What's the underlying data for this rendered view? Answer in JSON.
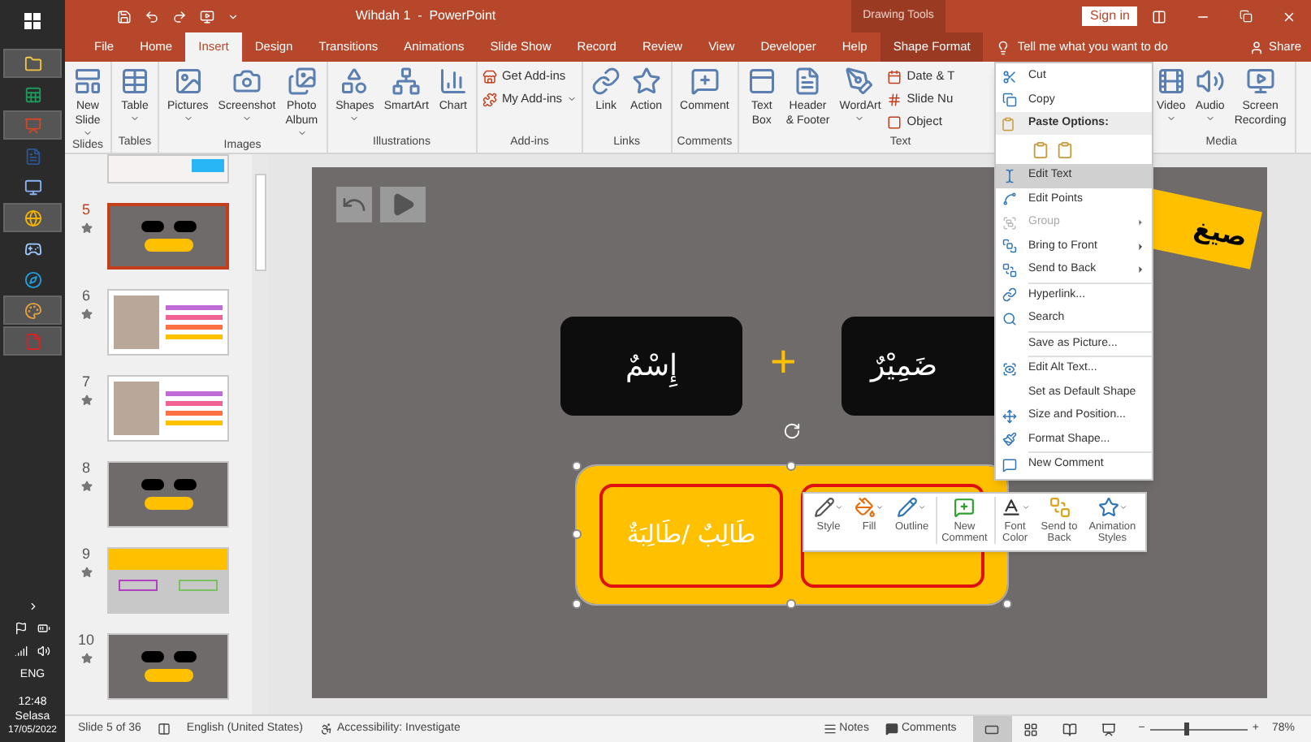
{
  "taskbar": {
    "apps": [
      {
        "running": true
      },
      {
        "running": false
      },
      {
        "running": true
      },
      {
        "running": false
      },
      {
        "running": false
      },
      {
        "running": true
      },
      {
        "running": false
      },
      {
        "running": false
      },
      {
        "running": true
      },
      {
        "running": true
      }
    ],
    "language": "ENG",
    "time": "12:48",
    "day": "Selasa",
    "date": "17/05/2022"
  },
  "title_bar": {
    "title": "Wihdah 1  -  PowerPoint",
    "context_label": "Drawing Tools",
    "sign_in": "Sign in"
  },
  "tabs": [
    {
      "label": "File",
      "selected": false,
      "kind": "normal"
    },
    {
      "label": "Home",
      "selected": false,
      "kind": "normal"
    },
    {
      "label": "Insert",
      "selected": true,
      "kind": "normal"
    },
    {
      "label": "Design",
      "selected": false,
      "kind": "normal"
    },
    {
      "label": "Transitions",
      "selected": false,
      "kind": "normal"
    },
    {
      "label": "Animations",
      "selected": false,
      "kind": "normal"
    },
    {
      "label": "Slide Show",
      "selected": false,
      "kind": "normal"
    },
    {
      "label": "Record",
      "selected": false,
      "kind": "normal"
    },
    {
      "label": "Review",
      "selected": false,
      "kind": "normal"
    },
    {
      "label": "View",
      "selected": false,
      "kind": "normal"
    },
    {
      "label": "Developer",
      "selected": false,
      "kind": "normal"
    },
    {
      "label": "Help",
      "selected": false,
      "kind": "normal"
    },
    {
      "label": "Shape Format",
      "selected": false,
      "kind": "contextual"
    }
  ],
  "tell_me": "Tell me what you want to do",
  "share": "Share",
  "ribbon": [
    {
      "label": "Slides",
      "buttons": [
        {
          "label": "New\nSlide",
          "kind": "large",
          "dropdown": true
        }
      ]
    },
    {
      "label": "Tables",
      "buttons": [
        {
          "label": "Table",
          "kind": "large",
          "dropdown": true
        }
      ]
    },
    {
      "label": "Images",
      "buttons": [
        {
          "label": "Pictures",
          "kind": "large",
          "dropdown": true
        },
        {
          "label": "Screenshot",
          "kind": "large",
          "dropdown": true
        },
        {
          "label": "Photo\nAlbum",
          "kind": "large",
          "dropdown": true
        }
      ]
    },
    {
      "label": "Illustrations",
      "buttons": [
        {
          "label": "Shapes",
          "kind": "large",
          "dropdown": true
        },
        {
          "label": "SmartArt",
          "kind": "large",
          "dropdown": false
        },
        {
          "label": "Chart",
          "kind": "large",
          "dropdown": false
        }
      ]
    },
    {
      "label": "Add-ins",
      "buttons": [
        {
          "label": "Get Add-ins",
          "kind": "small",
          "dropdown": false
        },
        {
          "label": "My Add-ins",
          "kind": "small",
          "dropdown": true
        }
      ]
    },
    {
      "label": "Links",
      "buttons": [
        {
          "label": "Link",
          "kind": "large",
          "dropdown": false
        },
        {
          "label": "Action",
          "kind": "large",
          "dropdown": false
        }
      ]
    },
    {
      "label": "Comments",
      "buttons": [
        {
          "label": "Comment",
          "kind": "large",
          "dropdown": false
        }
      ]
    },
    {
      "label": "Text",
      "buttons": [
        {
          "label": "Text\nBox",
          "kind": "large",
          "dropdown": false
        },
        {
          "label": "Header\n& Footer",
          "kind": "large",
          "dropdown": false
        },
        {
          "label": "WordArt",
          "kind": "large",
          "dropdown": true
        },
        {
          "label": "Date & T",
          "kind": "small",
          "dropdown": false
        },
        {
          "label": "Slide Nu",
          "kind": "small",
          "dropdown": false
        },
        {
          "label": "Object",
          "kind": "small",
          "dropdown": false
        }
      ]
    },
    {
      "label": "Media",
      "buttons": [
        {
          "label": "Video",
          "kind": "large",
          "dropdown": true
        },
        {
          "label": "Audio",
          "kind": "large",
          "dropdown": true
        },
        {
          "label": "Screen\nRecording",
          "kind": "large",
          "dropdown": false
        }
      ]
    }
  ],
  "thumbnails": [
    {
      "kind": "light",
      "selected": false
    },
    {
      "number": "5",
      "kind": "dark",
      "selected": true
    },
    {
      "number": "6",
      "kind": "photo",
      "selected": false
    },
    {
      "number": "7",
      "kind": "photo",
      "selected": false
    },
    {
      "number": "8",
      "kind": "dark",
      "selected": false
    },
    {
      "number": "9",
      "kind": "banner",
      "selected": false
    },
    {
      "number": "10",
      "kind": "dark",
      "selected": false
    }
  ],
  "slide": {
    "tag": "صيغ",
    "boxes": [
      {
        "text": "ضَمِيْرٌ"
      },
      {
        "text": "إِسْمٌ"
      }
    ],
    "plus": "+",
    "group": {
      "cell_text": "طَالِبٌ /طَالِبَةٌ",
      "selected": true
    }
  },
  "context_menu": [
    {
      "kind": "item",
      "label": "Cut",
      "selected": false,
      "disabled": false,
      "submenu": false
    },
    {
      "kind": "item",
      "label": "Copy",
      "selected": false,
      "disabled": false,
      "submenu": false
    },
    {
      "kind": "header",
      "label": "Paste Options:"
    },
    {
      "kind": "paste"
    },
    {
      "kind": "item",
      "label": "Edit Text",
      "selected": true,
      "disabled": false,
      "submenu": false
    },
    {
      "kind": "item",
      "label": "Edit Points",
      "selected": false,
      "disabled": false,
      "submenu": false
    },
    {
      "kind": "item",
      "label": "Group",
      "selected": false,
      "disabled": true,
      "submenu": true
    },
    {
      "kind": "item",
      "label": "Bring to Front",
      "selected": false,
      "disabled": false,
      "submenu": true
    },
    {
      "kind": "item",
      "label": "Send to Back",
      "selected": false,
      "disabled": false,
      "submenu": true
    },
    {
      "kind": "separator"
    },
    {
      "kind": "item",
      "label": "Hyperlink...",
      "selected": false,
      "disabled": false,
      "submenu": false
    },
    {
      "kind": "item",
      "label": "Search",
      "selected": false,
      "disabled": false,
      "submenu": false
    },
    {
      "kind": "separator"
    },
    {
      "kind": "item",
      "label": "Save as Picture...",
      "selected": false,
      "disabled": false,
      "submenu": false
    },
    {
      "kind": "separator"
    },
    {
      "kind": "item",
      "label": "Edit Alt Text...",
      "selected": false,
      "disabled": false,
      "submenu": false
    },
    {
      "kind": "item",
      "label": "Set as Default Shape",
      "selected": false,
      "disabled": false,
      "submenu": false
    },
    {
      "kind": "item",
      "label": "Size and Position...",
      "selected": false,
      "disabled": false,
      "submenu": false
    },
    {
      "kind": "item",
      "label": "Format Shape...",
      "selected": false,
      "disabled": false,
      "submenu": false
    },
    {
      "kind": "separator"
    },
    {
      "kind": "item",
      "label": "New Comment",
      "selected": false,
      "disabled": false,
      "submenu": false
    }
  ],
  "mini_toolbar": [
    {
      "label": "Style",
      "dropdown": true
    },
    {
      "label": "Fill",
      "dropdown": true
    },
    {
      "label": "Outline",
      "dropdown": true
    },
    {
      "label": "New\nComment",
      "dropdown": false
    },
    {
      "label": "Font\nColor",
      "dropdown": true
    },
    {
      "label": "Send to\nBack",
      "dropdown": false
    },
    {
      "label": "Animation\nStyles",
      "dropdown": true
    }
  ],
  "status_bar": {
    "slide_info": "Slide 5 of 36",
    "language": "English (United States)",
    "accessibility": "Accessibility: Investigate",
    "notes": "Notes",
    "comments": "Comments",
    "views": [
      {
        "selected": true
      },
      {
        "selected": false
      },
      {
        "selected": false
      },
      {
        "selected": false
      }
    ],
    "zoom": {
      "minus": "−",
      "plus": "+",
      "level": 0.38,
      "reading": "78%"
    }
  }
}
